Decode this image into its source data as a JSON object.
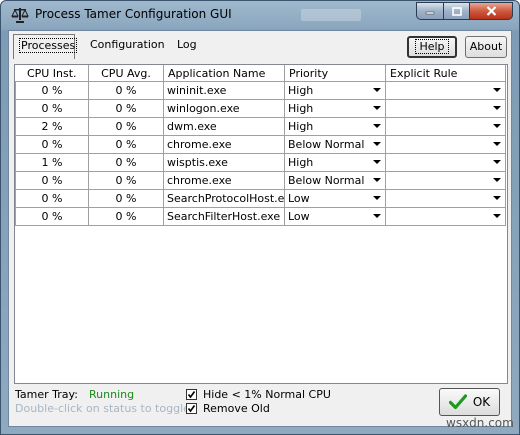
{
  "window": {
    "title": "Process Tamer Configuration GUI"
  },
  "tabs": [
    {
      "label": "Processes",
      "active": true
    },
    {
      "label": "Configuration",
      "active": false
    },
    {
      "label": "Log",
      "active": false
    }
  ],
  "buttons": {
    "help": "Help",
    "about": "About",
    "ok": "OK"
  },
  "grid": {
    "columns": [
      "CPU Inst.",
      "CPU Avg.",
      "Application Name",
      "Priority",
      "Explicit Rule"
    ],
    "rows": [
      {
        "cpu_inst": "0 %",
        "cpu_avg": "0 %",
        "app": "wininit.exe",
        "priority": "High",
        "rule": ""
      },
      {
        "cpu_inst": "0 %",
        "cpu_avg": "0 %",
        "app": "winlogon.exe",
        "priority": "High",
        "rule": ""
      },
      {
        "cpu_inst": "2 %",
        "cpu_avg": "0 %",
        "app": "dwm.exe",
        "priority": "High",
        "rule": ""
      },
      {
        "cpu_inst": "0 %",
        "cpu_avg": "0 %",
        "app": "chrome.exe",
        "priority": "Below Normal",
        "rule": ""
      },
      {
        "cpu_inst": "1 %",
        "cpu_avg": "0 %",
        "app": "wisptis.exe",
        "priority": "High",
        "rule": ""
      },
      {
        "cpu_inst": "0 %",
        "cpu_avg": "0 %",
        "app": "chrome.exe",
        "priority": "Below Normal",
        "rule": ""
      },
      {
        "cpu_inst": "0 %",
        "cpu_avg": "0 %",
        "app": "SearchProtocolHost.exe",
        "priority": "Low",
        "rule": ""
      },
      {
        "cpu_inst": "0 %",
        "cpu_avg": "0 %",
        "app": "SearchFilterHost.exe",
        "priority": "Low",
        "rule": ""
      }
    ]
  },
  "tray": {
    "label": "Tamer Tray:",
    "status": "Running",
    "hint": "Double-click on status to toggle.",
    "status_color": "#1a8a1a"
  },
  "options": {
    "hide_low_cpu": {
      "label": "Hide < 1% Normal CPU",
      "checked": true
    },
    "remove_old": {
      "label": "Remove Old",
      "checked": true
    }
  },
  "icons": {
    "app": "scales-icon",
    "ok": "checkmark-icon"
  },
  "watermark": "wsxdn.com"
}
